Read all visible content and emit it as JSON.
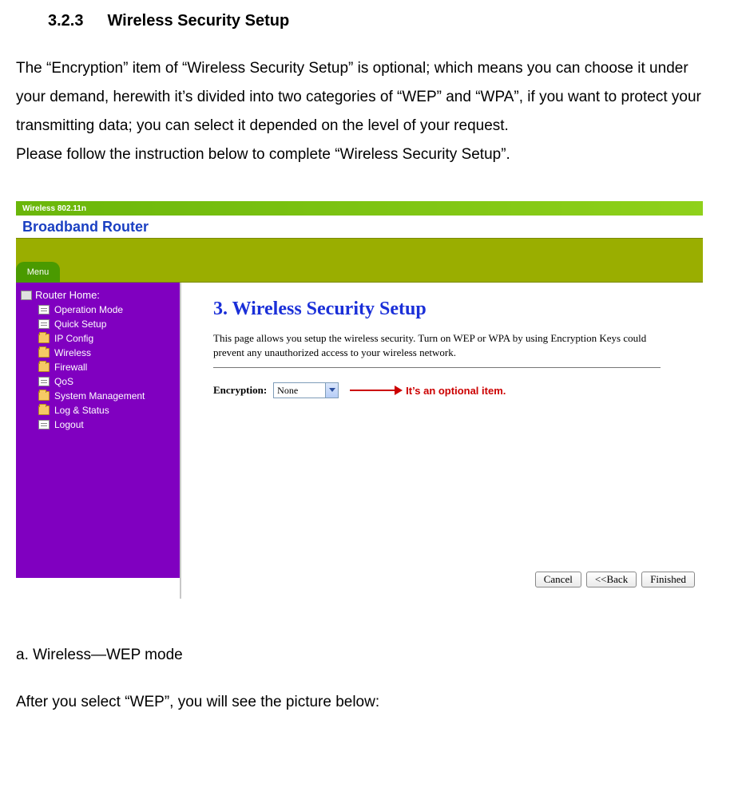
{
  "doc": {
    "section_number": "3.2.3",
    "section_title": "Wireless Security Setup",
    "paragraph1": "The “Encryption” item of “Wireless Security Setup” is optional; which means you can choose it under your demand, herewith it’s divided into two categories of “WEP” and “WPA”, if you want to protect your transmitting data; you can select it depended on the level of your request.",
    "paragraph2": "Please follow the instruction below to complete “Wireless Security Setup”.",
    "sub_heading": "a. Wireless—WEP mode",
    "paragraph3": "After you select “WEP”, you will see the picture below:"
  },
  "screenshot": {
    "titlebar": "Wireless 802.11n",
    "brand": "Broadband Router",
    "menu_tab": "Menu",
    "sidebar": {
      "root": "Router Home:",
      "items": [
        {
          "label": "Operation Mode",
          "icon": "doc"
        },
        {
          "label": "Quick Setup",
          "icon": "doc"
        },
        {
          "label": "IP Config",
          "icon": "folder"
        },
        {
          "label": "Wireless",
          "icon": "folder"
        },
        {
          "label": "Firewall",
          "icon": "folder"
        },
        {
          "label": "QoS",
          "icon": "doc"
        },
        {
          "label": "System Management",
          "icon": "folder"
        },
        {
          "label": "Log & Status",
          "icon": "folder"
        },
        {
          "label": "Logout",
          "icon": "doc"
        }
      ]
    },
    "content": {
      "page_title": "3. Wireless Security Setup",
      "page_desc": "This page allows you setup the wireless security. Turn on WEP or WPA by using Encryption Keys could prevent any unauthorized access to your wireless network.",
      "encryption_label": "Encryption:",
      "encryption_value": "None",
      "callout": "It’s an optional item.",
      "buttons": {
        "cancel": "Cancel",
        "back": "<<Back",
        "finished": "Finished"
      }
    }
  }
}
